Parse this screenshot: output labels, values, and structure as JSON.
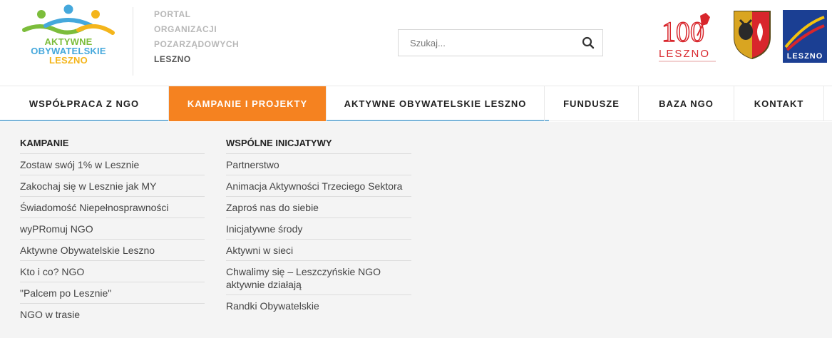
{
  "logo": {
    "line1": "AKTYWNE",
    "line2": "OBYWATELSKIE",
    "line3": "LESZNO"
  },
  "portal": {
    "lines": [
      "PORTAL",
      "ORGANIZACJI",
      "POZARZĄDOWYCH",
      "LESZNO"
    ]
  },
  "search": {
    "placeholder": "Szukaj...",
    "icon": "search-icon"
  },
  "emblems": {
    "leszno100_text": "LESZNO",
    "leszno_region_text": "LESZNO"
  },
  "nav": {
    "items": [
      {
        "label": "WSPÓŁPRACA Z NGO"
      },
      {
        "label": "KAMPANIE I PROJEKTY"
      },
      {
        "label": "AKTYWNE OBYWATELSKIE LESZNO"
      },
      {
        "label": "FUNDUSZE"
      },
      {
        "label": "BAZA NGO"
      },
      {
        "label": "KONTAKT"
      }
    ],
    "active_color": "#f58220"
  },
  "dropdown": {
    "kampanie": {
      "title": "KAMPANIE",
      "links": [
        "Zostaw swój 1% w Lesznie",
        "Zakochaj się w Lesznie jak MY",
        "Świadomość Niepełnosprawności",
        "wyPRomuj NGO",
        "Aktywne Obywatelskie Leszno",
        "Kto i co? NGO",
        "\"Palcem po Lesznie\"",
        "NGO w trasie"
      ]
    },
    "inicjatywy": {
      "title": "WSPÓLNE INICJATYWY",
      "links": [
        "Partnerstwo",
        "Animacja Aktywności Trzeciego Sektora",
        "Zaproś nas do siebie",
        "Inicjatywne środy",
        "Aktywni w sieci",
        "Chwalimy się – Leszczyńskie NGO aktywnie działają",
        "Randki Obywatelskie"
      ]
    }
  }
}
